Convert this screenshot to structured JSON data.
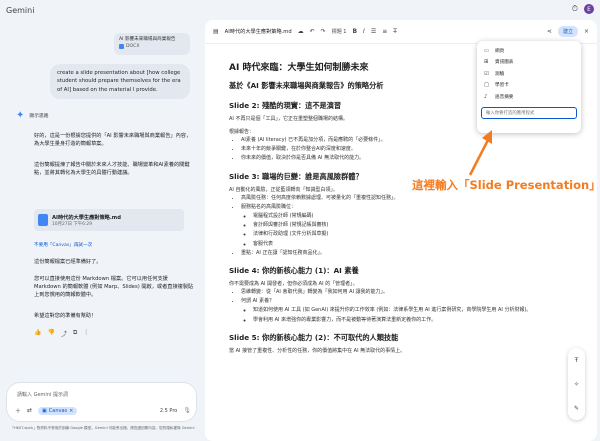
{
  "app": {
    "title": "Gemini"
  },
  "top": {
    "avatar_letter": "E"
  },
  "chat": {
    "attachment": {
      "title": "AI 影響未來職場與商業報告",
      "type": "DOCX"
    },
    "user_message": "create a slide presentation about [how college student should prepare themselves for the era of AI] based on the material I provide.",
    "thinking_label": "顯示思路",
    "reply_1": "好的，這是一份根據您提供的「AI 影響未來職場與商業報告」內容，為大學生量身打造的簡報草案。",
    "reply_2": "這份簡報提煉了報告中關於未來人才技能、職場變革和AI素養的關鍵點，並將其轉化為大學生的具體行動建議。",
    "file_card": {
      "name": "AI時代的大學生應對策略.md",
      "date": "10月27日 下午6:29"
    },
    "links": [
      "不要用「Canvas」再試一次"
    ],
    "reply_3": "這份簡報檔案已經準備好了。",
    "reply_4": "您可以直接使用這份 Markdown 檔案。它可以用任何支援 Markdown 的簡報軟體 (例如 Marp、Slides) 開啟，或者直接複製貼上到您慣用的簡報軟體中。",
    "reply_5": "希望這對您的準備有幫助！",
    "input_placeholder": "請輸入 Gemini 提示詞",
    "canvas_chip": "Canvas",
    "model": "2.5 Pro",
    "disclaimer": "「HKIIT-work」對資料不會用於訓練 Google 模型。Gemini 可能會出錯，請查證回覆內容。您的隱私權與 Gemini"
  },
  "doc": {
    "title": "AI時代的大學生應對策略.md",
    "heading_select": "標題 1",
    "share_label": "建立",
    "h1": "AI 時代來臨：大學生如何制勝未來",
    "subtitle": "基於《AI 影響未來職場與商業報告》的策略分析",
    "s2_title": "Slide 2: 殘酷的現實：這不是演習",
    "s2_intro": "AI 不再只是個「工具」，它正在重塑整個職場的結構。",
    "s2_report": "根據報告：",
    "s2_bullets": [
      "AI素養 (AI literacy) 已不再是加分項，而是應聘的「必要條件」。",
      "未來十年的競爭關鍵，在於你整合AI的深度和速度。",
      "你未來的價值，取決於你是否具備 AI 無法取代的能力。"
    ],
    "s3_title": "Slide 3: 職場的巨變：誰是高風險群體？",
    "s3_intro": "AI 自動化的風險，正從藍領轉向「知識型白領」。",
    "s3_b1": "高風險任務：任何高度依賴數據處理、可被量化的「重複性認知任務」。",
    "s3_b2": "服務點名的高風險職位：",
    "s3_sub": [
      "電腦程式設計師 (常規編碼)",
      "會計師與審計師 (常規記帳與審核)",
      "法律和行政助理 (文件分析與草擬)",
      "客服代表"
    ],
    "s3_b3": "重點：AI 正在讓「認知任務商品化」。",
    "s4_title": "Slide 4: 你的新核心能力 (1)：AI 素養",
    "s4_intro": "你不需要成為 AI 開發者，但你必須成為 AI 的「管理者」。",
    "s4_b1": "思維轉變：從「AI 會取代我」轉變為「我如何用 AI 讓我的能力」。",
    "s4_b2": "何謂 AI 素養？",
    "s4_sub": [
      "知道如何使用 AI 工具 (如 GenAI) 來提升你的工作效率 (例如：法律系學生用 AI 進行案例研究，商學院學生用 AI 分析財報)。",
      "學會利用 AI 來增強你的專業影響力，而不是被動等待著演算法重新定義你的工作。"
    ],
    "s5_title": "Slide 5: 你的新核心能力 (2)：不可取代的人類技能",
    "s5_intro": "當 AI 接管了重複性、分析性的任務，你的價值將集中在 AI 無法取代的事情上。"
  },
  "dropdown": {
    "items": [
      {
        "icon": "web-icon",
        "label": "網頁"
      },
      {
        "icon": "infographic-icon",
        "label": "資訊圖表"
      },
      {
        "icon": "quiz-icon",
        "label": "測驗"
      },
      {
        "icon": "flashcard-icon",
        "label": "學習卡"
      },
      {
        "icon": "audio-icon",
        "label": "語音摘要"
      }
    ],
    "input_placeholder": "輸入你要打造的應用程式"
  },
  "annotation": {
    "text": "這裡輸入「Slide Presentation」",
    "color": "#f47c20"
  }
}
